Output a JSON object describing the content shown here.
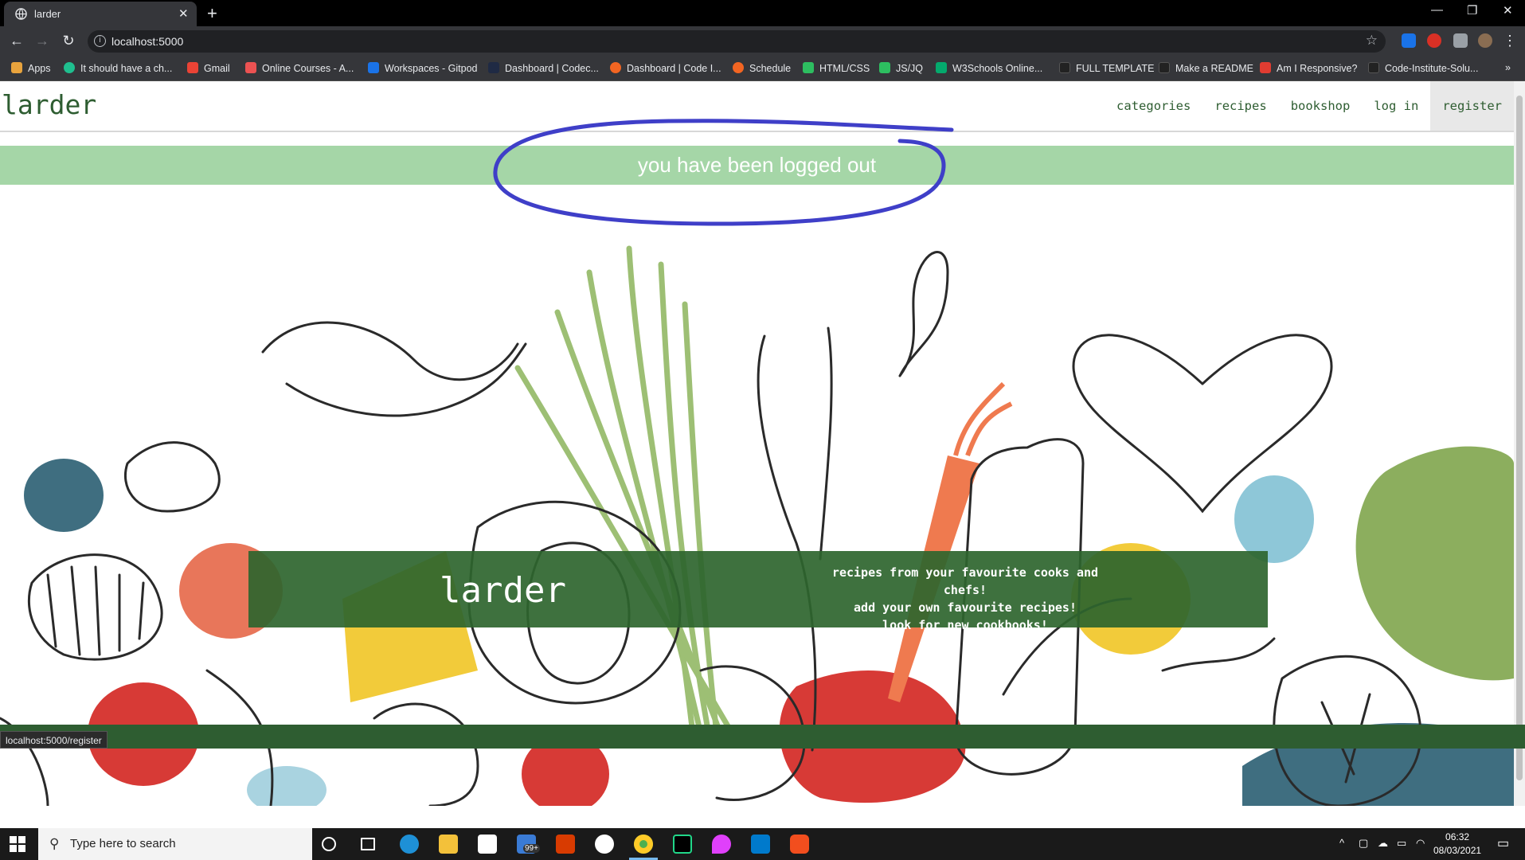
{
  "browser": {
    "tab_title": "larder",
    "tab_close": "✕",
    "new_tab": "+",
    "url": "localhost:5000",
    "bookmarks": [
      {
        "label": "Apps",
        "color": "#e8a33d"
      },
      {
        "label": "It should have a ch...",
        "color": "#1fbf8f"
      },
      {
        "label": "Gmail",
        "color": "#ea4335"
      },
      {
        "label": "Online Courses - A...",
        "color": "#ec5252"
      },
      {
        "label": "Workspaces - Gitpod",
        "color": "#1a73e8"
      },
      {
        "label": "Dashboard | Codec...",
        "color": "#1f2a44"
      },
      {
        "label": "Dashboard | Code I...",
        "color": "#f26522"
      },
      {
        "label": "Schedule",
        "color": "#f26522"
      },
      {
        "label": "HTML/CSS",
        "color": "#2dbe60"
      },
      {
        "label": "JS/JQ",
        "color": "#2dbe60"
      },
      {
        "label": "W3Schools Online...",
        "color": "#04aa6d"
      },
      {
        "label": "FULL TEMPLATE",
        "color": "#222222"
      },
      {
        "label": "Make a README",
        "color": "#222222"
      },
      {
        "label": "Am I Responsive?",
        "color": "#e03c31"
      },
      {
        "label": "Code-Institute-Solu...",
        "color": "#222222"
      }
    ],
    "status_url": "localhost:5000/register"
  },
  "site": {
    "brand": "larder",
    "nav": [
      "categories",
      "recipes",
      "bookshop",
      "log in",
      "register"
    ],
    "flash_message": "you have been logged out",
    "hero_title": "larder",
    "hero_tagline": [
      "recipes from your favourite cooks and chefs!",
      "add your own favourite recipes!",
      "look for new cookbooks!"
    ],
    "colors": {
      "brand_green": "#2e5d31",
      "flash_green": "#a5d6a7",
      "annotation_blue": "#3f3fc8"
    }
  },
  "taskbar": {
    "search_placeholder": "Type here to search",
    "mail_badge": "99+",
    "time": "06:32",
    "date": "08/03/2021"
  }
}
